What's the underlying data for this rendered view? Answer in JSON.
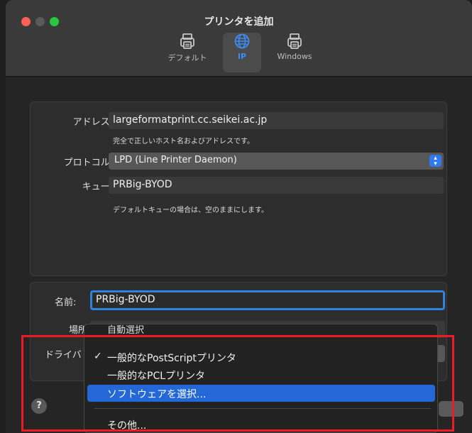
{
  "window": {
    "title": "プリンタを追加"
  },
  "toolbar": {
    "tabs": [
      {
        "label": "デフォルト",
        "icon": "printer-icon"
      },
      {
        "label": "IP",
        "icon": "globe-icon",
        "selected": true
      },
      {
        "label": "Windows",
        "icon": "printer-icon"
      }
    ]
  },
  "form": {
    "address": {
      "label": "アドレス:",
      "value": "largeformatprint.cc.seikei.ac.jp",
      "hint": "完全で正しいホスト名およびアドレスです。"
    },
    "protocol": {
      "label": "プロトコル:",
      "value": "LPD (Line Printer Daemon)"
    },
    "queue": {
      "label": "キュー:",
      "value": "PRBig-BYOD",
      "hint": "デフォルトキューの場合は、空のままにします。"
    },
    "name": {
      "label": "名前:",
      "value": "PRBig-BYOD"
    },
    "location": {
      "label": "場所"
    },
    "driver": {
      "label": "ドライバ"
    }
  },
  "driver_menu": {
    "items": [
      {
        "label": "自動選択"
      },
      {
        "label": "一般的なPostScriptプリンタ",
        "checked": true
      },
      {
        "label": "一般的なPCLプリンタ"
      },
      {
        "label": "ソフトウェアを選択...",
        "highlighted": true
      },
      {
        "label": "その他..."
      }
    ]
  },
  "footer": {
    "help_label": "?"
  },
  "colors": {
    "accent": "#2468d8",
    "highlight_box": "#ec1c24",
    "focus_ring": "#2e82e0"
  }
}
